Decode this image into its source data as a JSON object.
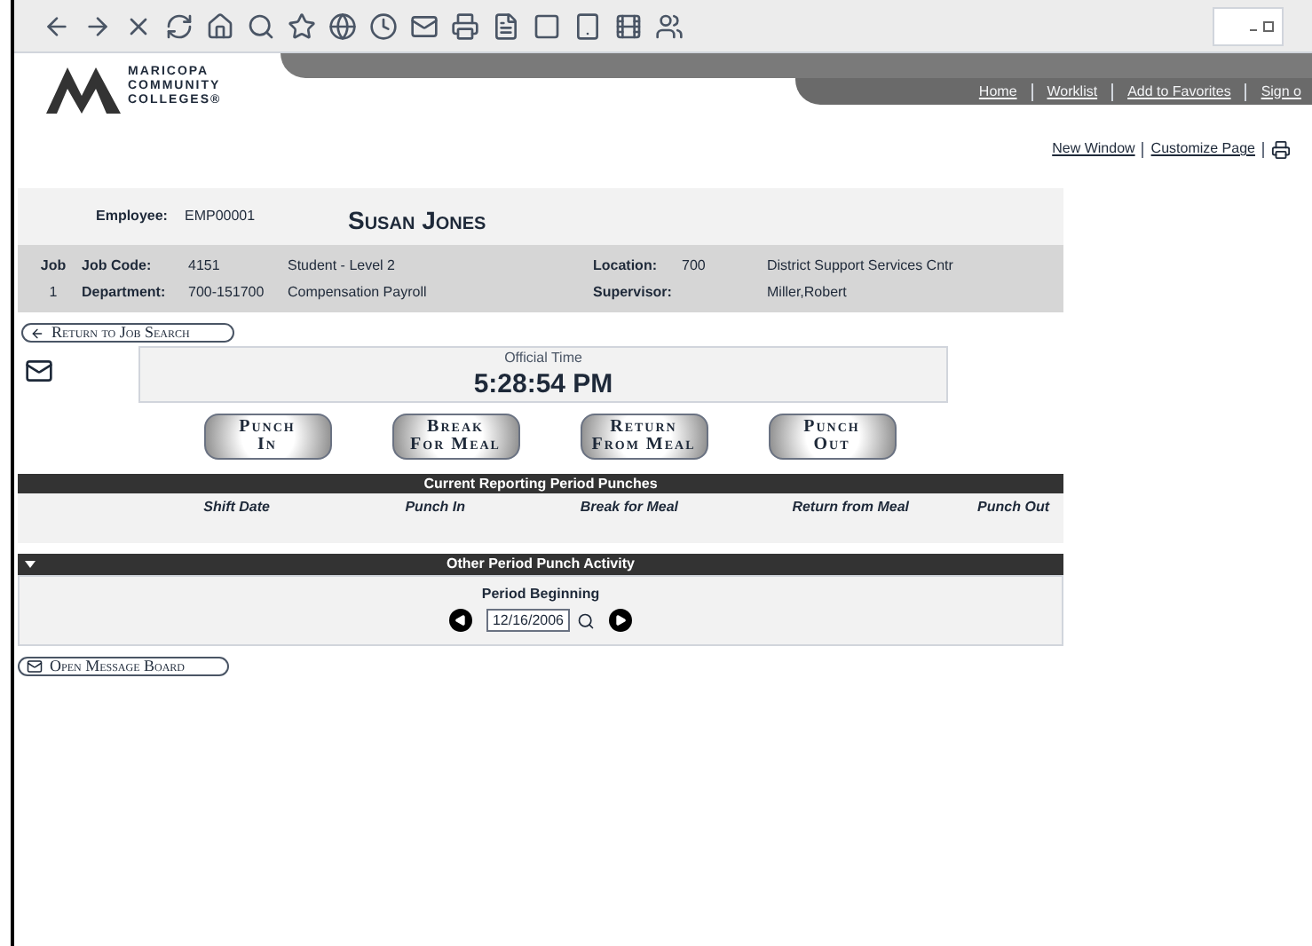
{
  "header": {
    "logo_lines": [
      "MARICOPA",
      "COMMUNITY",
      "COLLEGES®"
    ],
    "nav_links": [
      "Home",
      "Worklist",
      "Add to Favorites",
      "Sign o"
    ]
  },
  "page_links": [
    "New Window",
    "Customize Page"
  ],
  "employee": {
    "employee_label": "Employee:",
    "employee_id": "EMP00001",
    "name": "Susan Jones",
    "job_label": "Job",
    "job_number": "1",
    "job_code_label": "Job Code:",
    "job_code": "4151",
    "job_title": "Student - Level 2",
    "department_label": "Department:",
    "department_code": "700-151700",
    "department_name": "Compensation Payroll",
    "location_label": "Location:",
    "location_code": "700",
    "location_name": "District Support Services Cntr",
    "supervisor_label": "Supervisor:",
    "supervisor_name": "Miller,Robert"
  },
  "return_link": "Return to Job Search",
  "clock": {
    "label": "Official Time",
    "time": "5:28:54 PM"
  },
  "punch_buttons": [
    [
      "Punch",
      "In"
    ],
    [
      "Break",
      "For Meal"
    ],
    [
      "Return",
      "From Meal"
    ],
    [
      "Punch",
      "Out"
    ]
  ],
  "punches": {
    "title": "Current Reporting Period Punches",
    "columns": [
      "Shift Date",
      "Punch In",
      "Break for Meal",
      "Return from Meal",
      "Punch Out"
    ]
  },
  "other_activity": {
    "title": "Other Period Punch Activity",
    "expanded": true,
    "period_label": "Period Beginning",
    "period_value": "12/16/2006"
  },
  "message_board_link": "Open Message Board"
}
